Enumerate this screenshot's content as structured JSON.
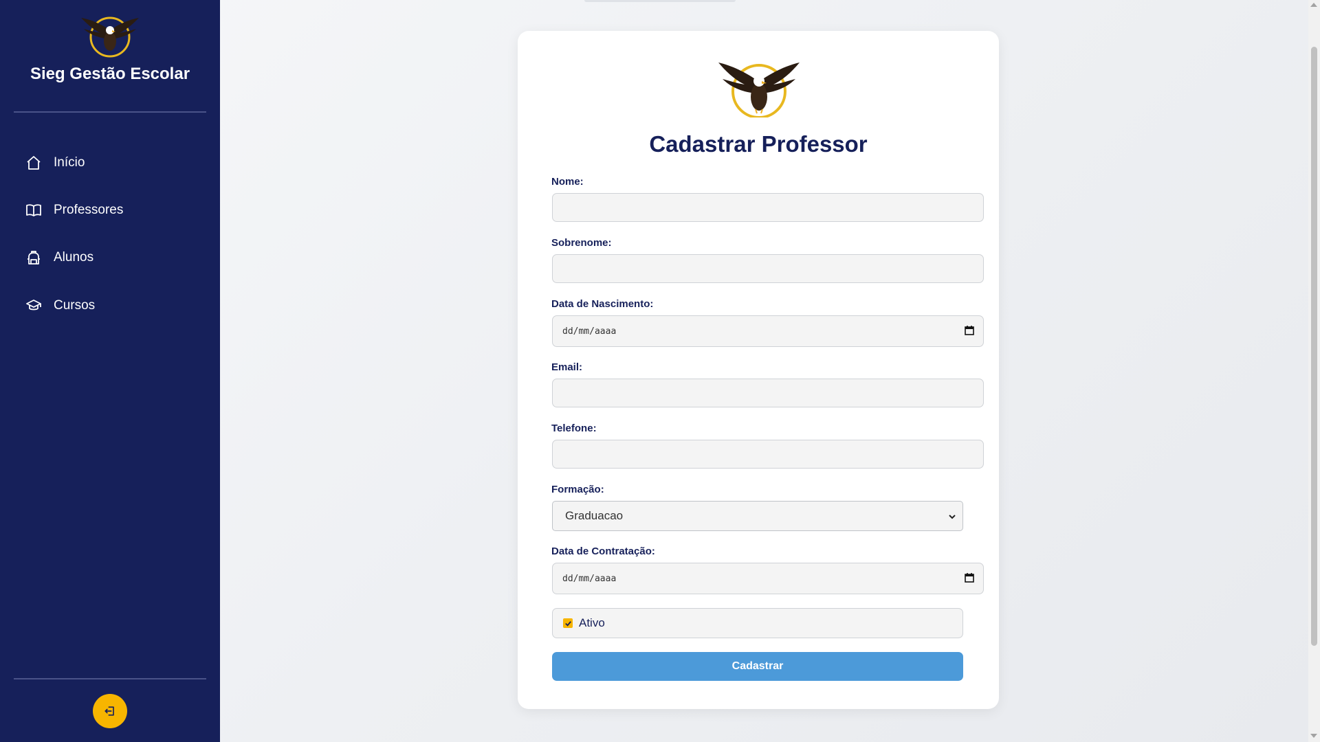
{
  "sidebar": {
    "title": "Sieg Gestão Escolar",
    "items": [
      {
        "label": "Início",
        "icon": "home-icon"
      },
      {
        "label": "Professores",
        "icon": "book-icon"
      },
      {
        "label": "Alunos",
        "icon": "backpack-icon"
      },
      {
        "label": "Cursos",
        "icon": "graduation-cap-icon"
      }
    ],
    "logout_icon": "logout-icon"
  },
  "form": {
    "title": "Cadastrar Professor",
    "fields": {
      "nome": {
        "label": "Nome:",
        "value": ""
      },
      "sobrenome": {
        "label": "Sobrenome:",
        "value": ""
      },
      "nascimento": {
        "label": "Data de Nascimento:",
        "placeholder": "dd/mm/aaaa"
      },
      "email": {
        "label": "Email:",
        "value": ""
      },
      "telefone": {
        "label": "Telefone:",
        "value": ""
      },
      "formacao": {
        "label": "Formação:",
        "selected": "Graduacao"
      },
      "contratacao": {
        "label": "Data de Contratação:",
        "placeholder": "dd/mm/aaaa"
      },
      "ativo": {
        "label": "Ativo",
        "checked": true
      }
    },
    "submit_label": "Cadastrar"
  },
  "colors": {
    "sidebar_bg": "#16205a",
    "accent": "#f7b500",
    "button": "#4c9ad9",
    "title": "#16205a"
  }
}
